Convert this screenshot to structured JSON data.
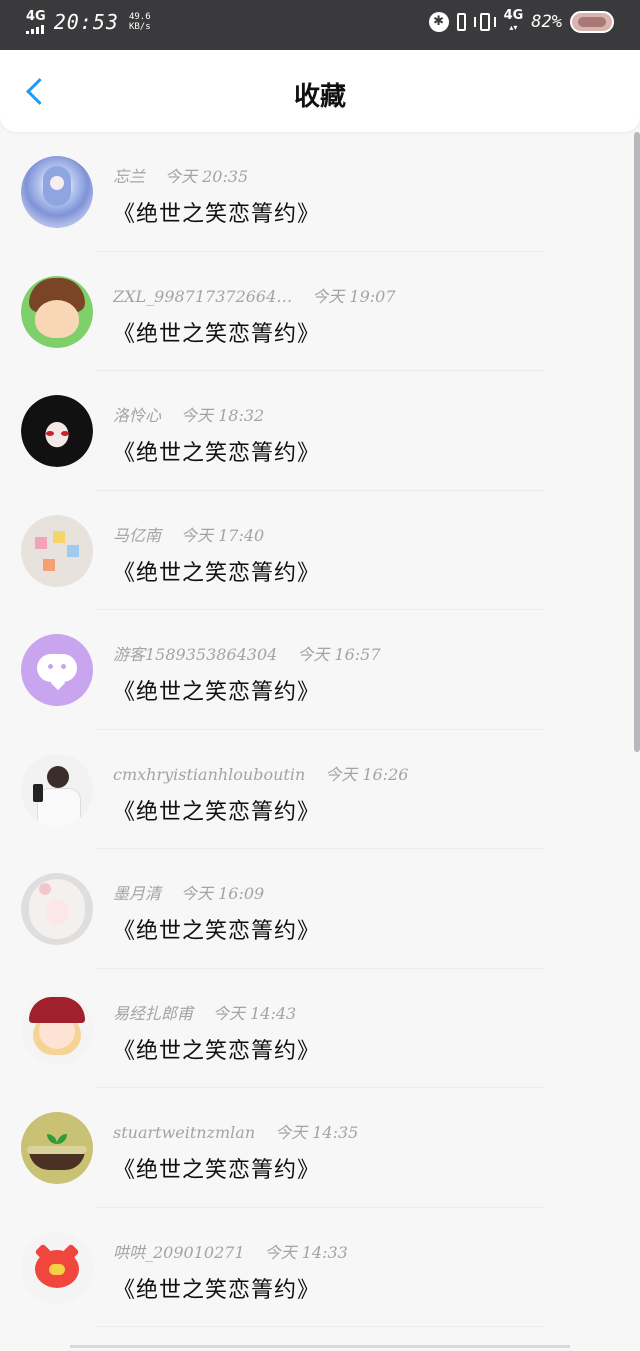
{
  "status_bar": {
    "network_type": "4G",
    "time": "20:53",
    "speed_value": "49.6",
    "speed_unit": "KB/s",
    "bluetooth_glyph": "✱",
    "data_type": "4G",
    "battery_percent": "82%"
  },
  "header": {
    "title": "收藏"
  },
  "favorites": [
    {
      "user": "忘兰",
      "time": "今天 20:35",
      "content": "《绝世之笑恋箐约》"
    },
    {
      "user": "ZXL_998717372664…",
      "time": "今天 19:07",
      "content": "《绝世之笑恋箐约》"
    },
    {
      "user": "洛怜心",
      "time": "今天 18:32",
      "content": "《绝世之笑恋箐约》"
    },
    {
      "user": "马亿南",
      "time": "今天 17:40",
      "content": "《绝世之笑恋箐约》"
    },
    {
      "user": "游客1589353864304",
      "time": "今天 16:57",
      "content": "《绝世之笑恋箐约》"
    },
    {
      "user": "cmxhryistianhlouboutin",
      "time": "今天 16:26",
      "content": "《绝世之笑恋箐约》"
    },
    {
      "user": "墨月清",
      "time": "今天 16:09",
      "content": "《绝世之笑恋箐约》"
    },
    {
      "user": "易经扎郎甫",
      "time": "今天 14:43",
      "content": "《绝世之笑恋箐约》"
    },
    {
      "user": "stuartweitnzmlan",
      "time": "今天 14:35",
      "content": "《绝世之笑恋箐约》"
    },
    {
      "user": "哄哄_209010271",
      "time": "今天 14:33",
      "content": "《绝世之笑恋箐约》"
    }
  ],
  "colors": {
    "accent": "#1b9af7",
    "status_bar_bg": "#3a3a3c",
    "page_bg": "#f7f7f8",
    "meta_text": "#a4a4a8"
  }
}
